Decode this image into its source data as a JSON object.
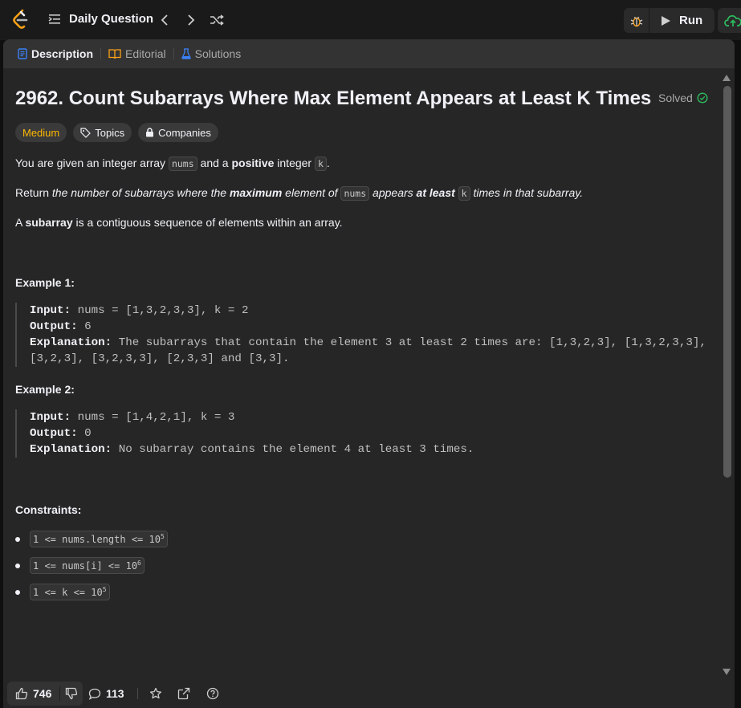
{
  "topbar": {
    "daily_label": "Daily Question",
    "run_label": "Run"
  },
  "tabs": [
    {
      "label": "Description",
      "active": true
    },
    {
      "label": "Editorial",
      "active": false
    },
    {
      "label": "Solutions",
      "active": false
    }
  ],
  "problem": {
    "title": "2962. Count Subarrays Where Max Element Appears at Least K Times",
    "status": "Solved",
    "difficulty": "Medium",
    "tag_topics": "Topics",
    "tag_companies": "Companies",
    "p1": {
      "a": "You are given an integer array ",
      "code1": "nums",
      "b": " and a ",
      "bold": "positive",
      "c": " integer ",
      "code2": "k",
      "d": "."
    },
    "p2": {
      "a": "Return ",
      "i1": "the number of subarrays where the ",
      "bi1": "maximum",
      "i2": " element of ",
      "code1": "nums",
      "i3": " appears ",
      "bi2": "at least",
      "code2": "k",
      "i4": " times in that subarray."
    },
    "p3": {
      "a": "A ",
      "bold": "subarray",
      "b": " is a contiguous sequence of elements within an array."
    }
  },
  "examples": [
    {
      "heading": "Example 1:",
      "input_label": "Input:",
      "input": "nums = [1,3,2,3,3], k = 2",
      "output_label": "Output:",
      "output": "6",
      "expl_label": "Explanation:",
      "expl_line1": "The subarrays that contain the element 3 at least 2 times are: [1,3,2,3], [1,3,2,3,3],",
      "expl_line2": "[3,2,3], [3,2,3,3], [2,3,3] and [3,3]."
    },
    {
      "heading": "Example 2:",
      "input_label": "Input:",
      "input": "nums = [1,4,2,1], k = 3",
      "output_label": "Output:",
      "output": "0",
      "expl_label": "Explanation:",
      "expl_line1": "No subarray contains the element 4 at least 3 times."
    }
  ],
  "constraints": {
    "heading": "Constraints:",
    "items": [
      {
        "text": "1 <= nums.length <= 10",
        "sup": "5"
      },
      {
        "text": "1 <= nums[i] <= 10",
        "sup": "6"
      },
      {
        "text": "1 <= k <= 10",
        "sup": "5"
      }
    ]
  },
  "bottom": {
    "likes": "746",
    "comments": "113"
  },
  "colors": {
    "background": "#262626",
    "difficulty_medium": "#ffb800",
    "solved_green": "#2cbb5d",
    "accent_blue": "#3b82f6"
  }
}
